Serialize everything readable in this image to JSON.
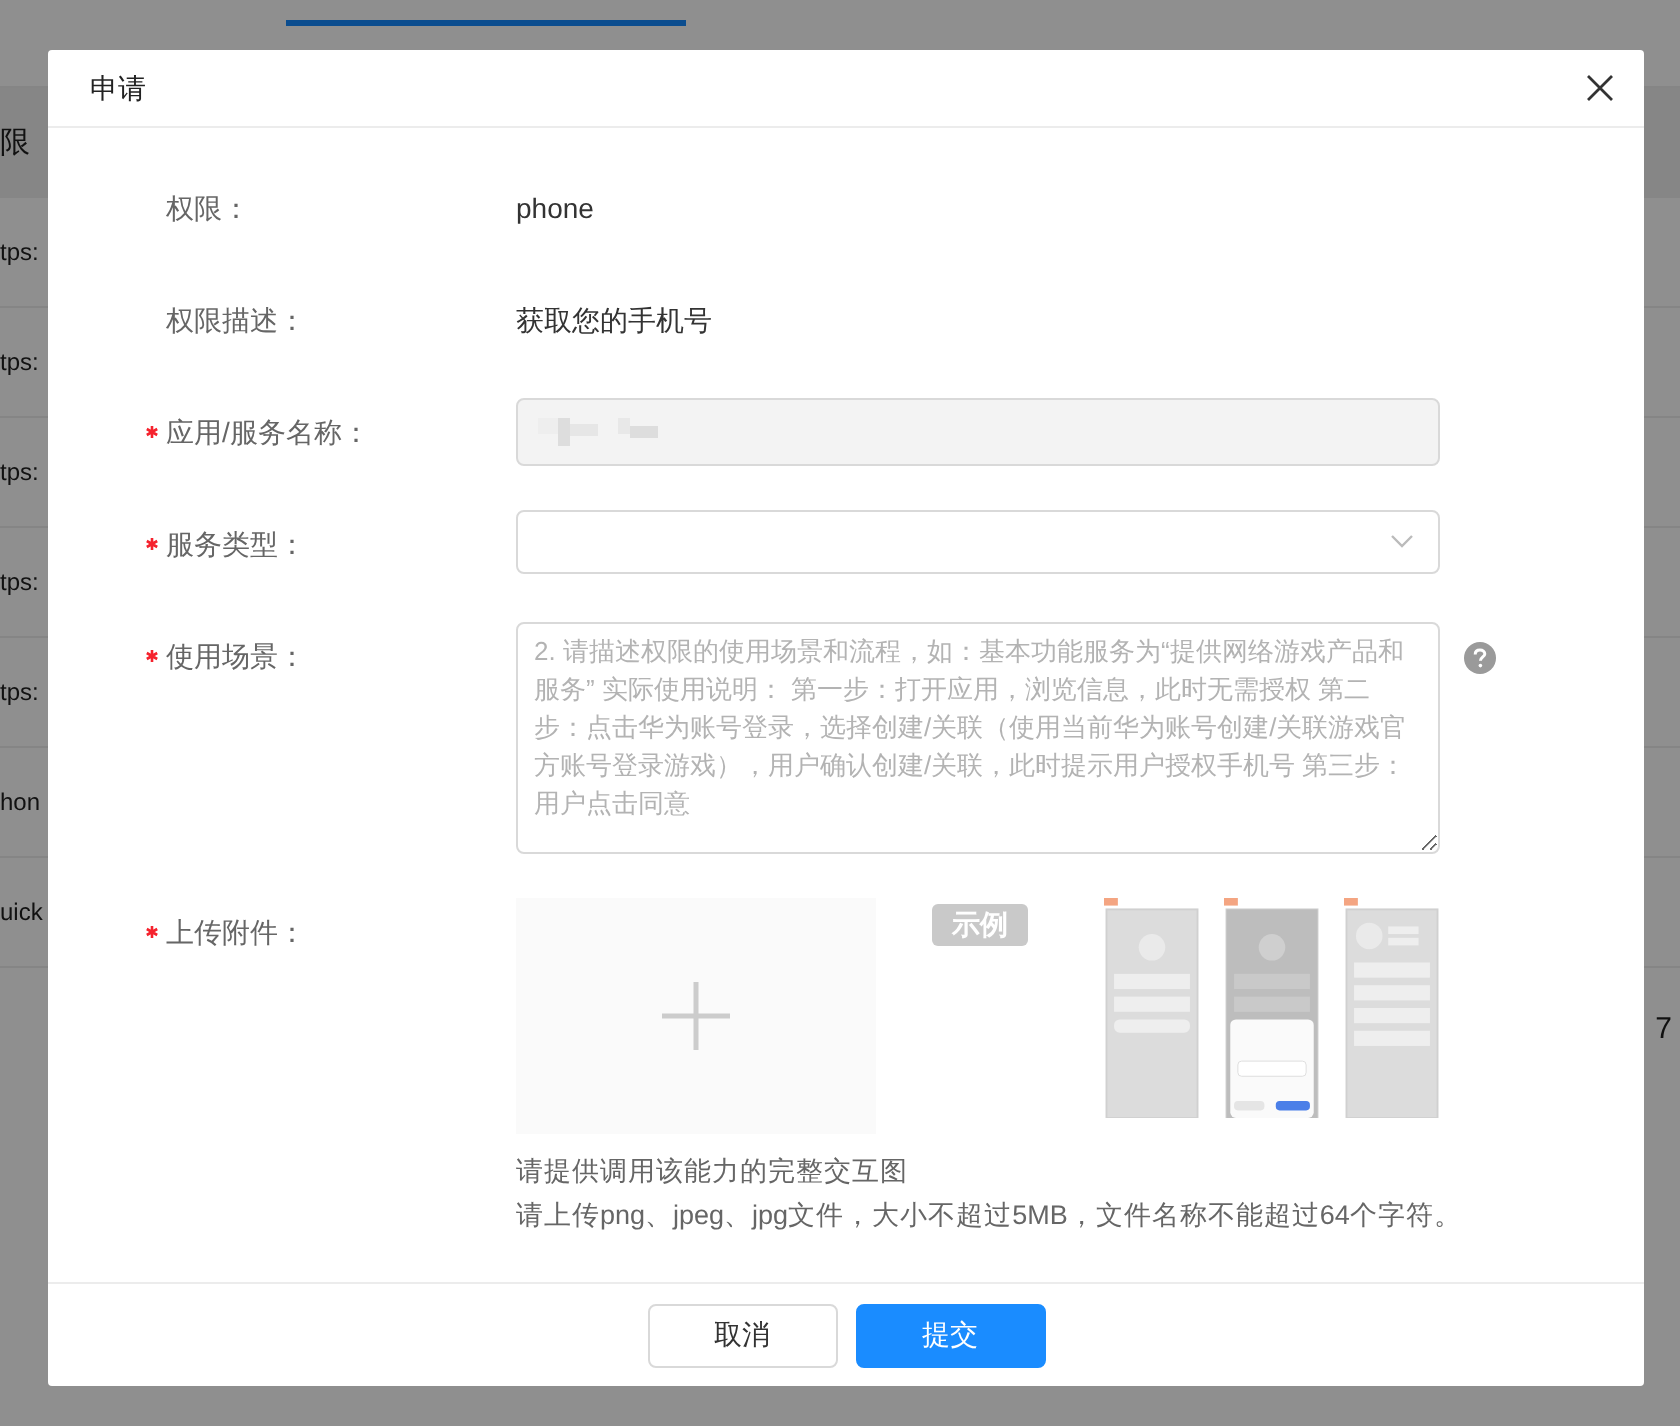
{
  "background": {
    "header_cell": "限",
    "rows": [
      "tps:",
      "tps:",
      "tps:",
      "tps:",
      "tps:",
      "hon",
      "uick"
    ],
    "side_text": "7"
  },
  "dialog": {
    "title": "申请"
  },
  "form": {
    "fields": [
      {
        "kind": "text",
        "label": "权限：",
        "required": false,
        "value": "phone"
      },
      {
        "kind": "text",
        "label": "权限描述：",
        "required": false,
        "value": "获取您的手机号"
      },
      {
        "kind": "redacted",
        "label": "应用/服务名称：",
        "required": true,
        "disabled": true
      },
      {
        "kind": "select",
        "label": "服务类型：",
        "required": true
      },
      {
        "kind": "textarea",
        "label": "使用场景：",
        "required": true,
        "placeholder": "2. 请描述权限的使用场景和流程，如：基本功能服务为“提供网络游戏产品和服务” 实际使用说明： 第一步：打开应用，浏览信息，此时无需授权 第二步：点击华为账号登录，选择创建/关联（使用当前华为账号创建/关联游戏官方账号登录游戏），用户确认创建/关联，此时提示用户授权手机号 第三步：用户点击同意"
      },
      {
        "kind": "upload",
        "label": "上传附件：",
        "required": true,
        "example_label": "示例",
        "hints": [
          "请提供调用该能力的完整交互图",
          "请上传png、jpeg、jpg文件，大小不超过5MB，文件名称不能超过64个字符。"
        ]
      }
    ]
  },
  "buttons": [
    {
      "label": "取消",
      "primary": false
    },
    {
      "label": "提交",
      "primary": true
    }
  ]
}
